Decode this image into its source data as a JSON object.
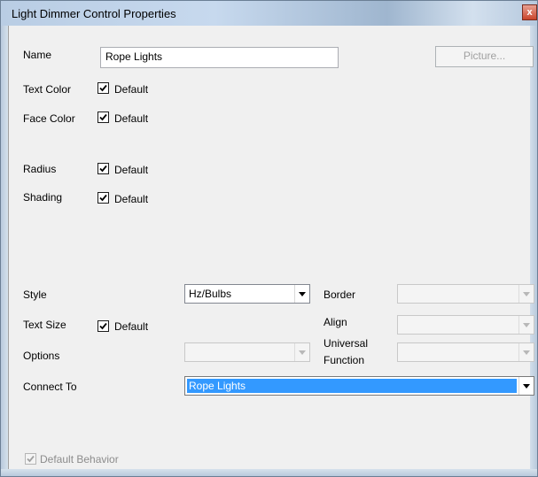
{
  "window": {
    "title": "Light Dimmer Control Properties",
    "close_label": "x"
  },
  "name": {
    "label": "Name",
    "value": "Rope Lights"
  },
  "picture_button": "Picture...",
  "text_color": {
    "label": "Text Color",
    "checkbox_label": "Default",
    "checked": true
  },
  "face_color": {
    "label": "Face Color",
    "checkbox_label": "Default",
    "checked": true
  },
  "radius": {
    "label": "Radius",
    "checkbox_label": "Default",
    "checked": true
  },
  "shading": {
    "label": "Shading",
    "checkbox_label": "Default",
    "checked": true
  },
  "style": {
    "label": "Style",
    "value": "Hz/Bulbs"
  },
  "border": {
    "label": "Border",
    "value": ""
  },
  "text_size": {
    "label": "Text Size",
    "checkbox_label": "Default",
    "checked": true
  },
  "align": {
    "label": "Align",
    "value": ""
  },
  "options": {
    "label": "Options",
    "value": ""
  },
  "universal_function": {
    "label_line1": "Universal",
    "label_line2": "Function",
    "value": ""
  },
  "connect_to": {
    "label": "Connect To",
    "value": "Rope Lights"
  },
  "default_behavior": {
    "label": "Default Behavior",
    "checked": true,
    "enabled": false
  },
  "icons": {
    "checkmark": "checkmark-icon",
    "dropdown": "chevron-down-icon",
    "close": "close-icon"
  }
}
